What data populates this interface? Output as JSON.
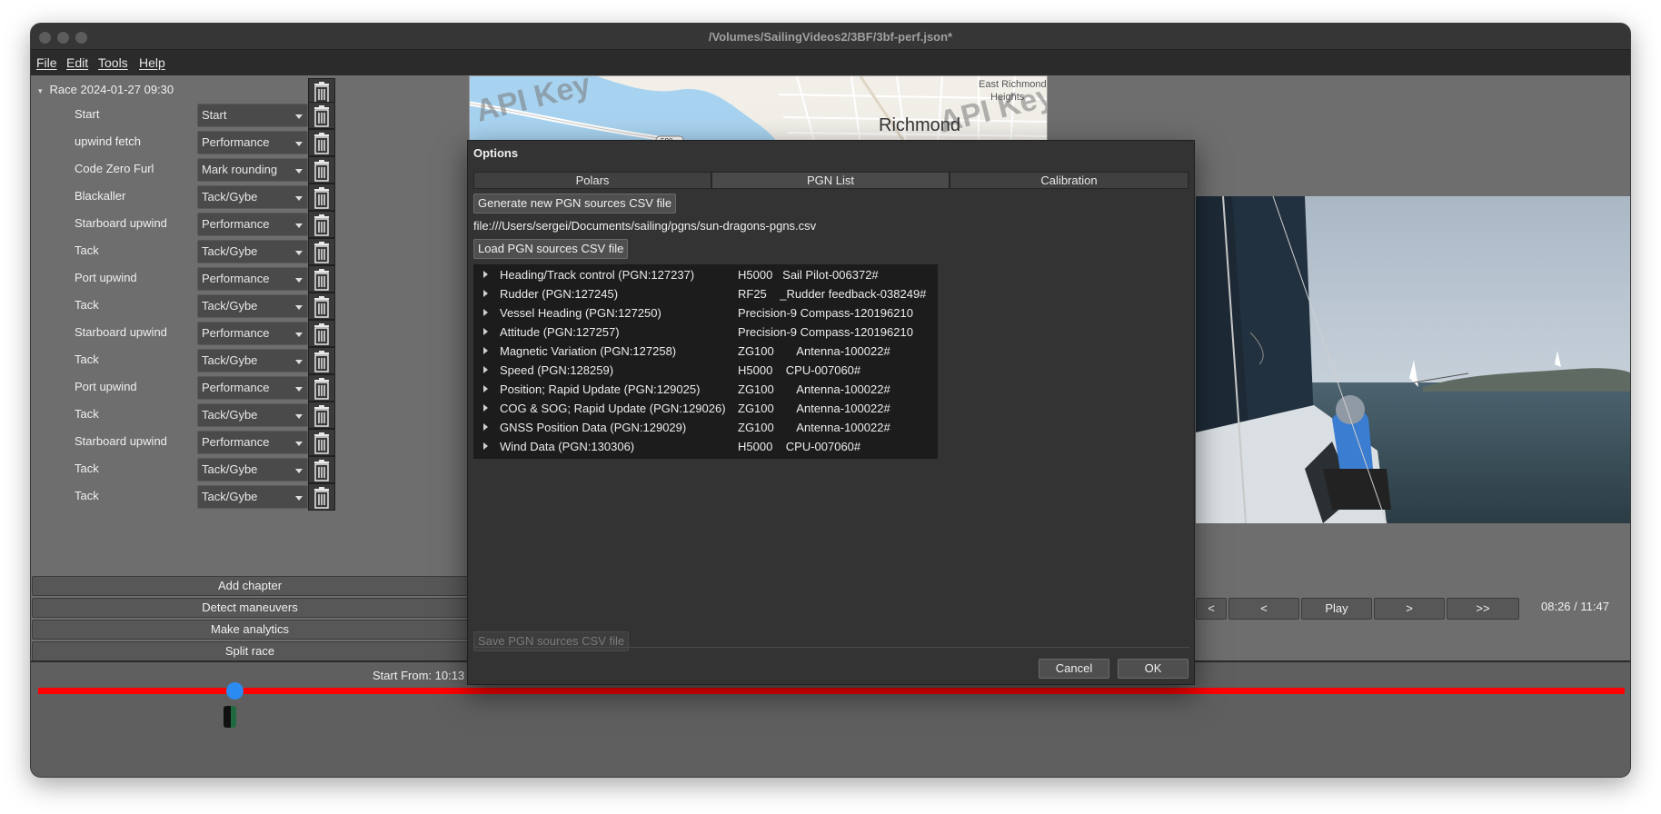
{
  "window": {
    "title": "/Volumes/SailingVideos2/3BF/3bf-perf.json*"
  },
  "menu": [
    "File",
    "Edit",
    "Tools",
    "Help"
  ],
  "race": {
    "label": "Race 2024-01-27 09:30"
  },
  "chapters": [
    {
      "label": "Start",
      "type": "Start"
    },
    {
      "label": "upwind fetch",
      "type": "Performance"
    },
    {
      "label": "Code Zero Furl",
      "type": "Mark rounding"
    },
    {
      "label": "Blackaller",
      "type": "Tack/Gybe"
    },
    {
      "label": "Starboard upwind",
      "type": "Performance"
    },
    {
      "label": "Tack",
      "type": "Tack/Gybe"
    },
    {
      "label": "Port upwind",
      "type": "Performance"
    },
    {
      "label": "Tack",
      "type": "Tack/Gybe"
    },
    {
      "label": "Starboard upwind",
      "type": "Performance"
    },
    {
      "label": "Tack",
      "type": "Tack/Gybe"
    },
    {
      "label": "Port upwind",
      "type": "Performance"
    },
    {
      "label": "Tack",
      "type": "Tack/Gybe"
    },
    {
      "label": "Starboard upwind",
      "type": "Performance"
    },
    {
      "label": "Tack",
      "type": "Tack/Gybe"
    },
    {
      "label": "Tack",
      "type": "Tack/Gybe"
    }
  ],
  "actions": [
    "Add chapter",
    "Detect maneuvers",
    "Make analytics",
    "Split race"
  ],
  "map": {
    "labels": [
      "East Richmond",
      "Heights",
      "Richmond",
      "580"
    ],
    "watermark": "API Key"
  },
  "player": {
    "buttons": [
      "<",
      "<",
      "Play",
      ">",
      ">>"
    ],
    "time": "08:26 / 11:47"
  },
  "timeline": {
    "label": "Start  From:  10:13"
  },
  "dialog": {
    "title": "Options",
    "tabs": [
      "Polars",
      "PGN List",
      "Calibration"
    ],
    "generate_btn": "Generate new PGN sources CSV file",
    "file_path": "file:///Users/sergei/Documents/sailing/pgns/sun-dragons-pgns.csv",
    "load_btn": "Load PGN sources CSV file",
    "save_btn": "Save PGN sources CSV file",
    "cancel_btn": "Cancel",
    "ok_btn": "OK",
    "pgns": [
      {
        "name": "Heading/Track control (PGN:127237)",
        "device": "H5000   Sail Pilot-006372#"
      },
      {
        "name": "Rudder (PGN:127245)",
        "device": "RF25    _Rudder feedback-038249#"
      },
      {
        "name": "Vessel Heading (PGN:127250)",
        "device": "Precision-9 Compass-120196210"
      },
      {
        "name": "Attitude (PGN:127257)",
        "device": "Precision-9 Compass-120196210"
      },
      {
        "name": "Magnetic Variation (PGN:127258)",
        "device": "ZG100       Antenna-100022#"
      },
      {
        "name": "Speed (PGN:128259)",
        "device": "H5000    CPU-007060#"
      },
      {
        "name": "Position; Rapid Update (PGN:129025)",
        "device": "ZG100       Antenna-100022#"
      },
      {
        "name": "COG & SOG; Rapid Update (PGN:129026)",
        "device": "ZG100       Antenna-100022#"
      },
      {
        "name": "GNSS Position Data (PGN:129029)",
        "device": "ZG100       Antenna-100022#"
      },
      {
        "name": "Wind Data (PGN:130306)",
        "device": "H5000    CPU-007060#"
      }
    ]
  }
}
